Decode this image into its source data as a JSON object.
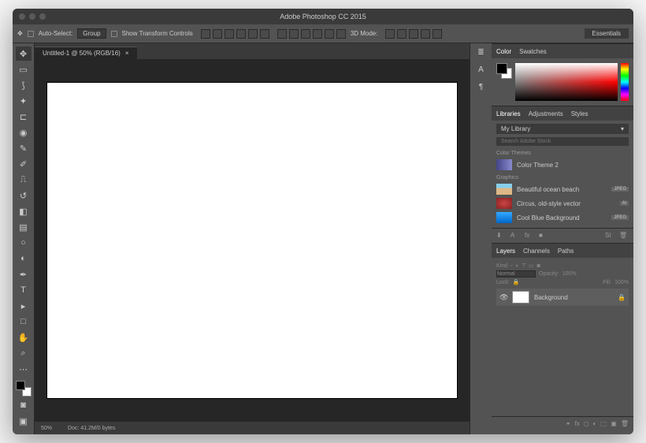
{
  "title": "Adobe Photoshop CC 2015",
  "options": {
    "auto_select": "Auto-Select:",
    "group": "Group",
    "show_transform": "Show Transform Controls",
    "mode_3d": "3D Mode:",
    "workspace": "Essentials"
  },
  "document": {
    "tab": "Untitled-1 @ 50% (RGB/16)",
    "tab_close": "×",
    "zoom": "50%",
    "doc_info": "Doc: 41.2M/0 bytes"
  },
  "panels": {
    "color": {
      "tab1": "Color",
      "tab2": "Swatches"
    },
    "libraries": {
      "tab1": "Libraries",
      "tab2": "Adjustments",
      "tab3": "Styles",
      "selected": "My Library",
      "search_placeholder": "Search Adobe Stock",
      "section_colors": "Color Themes",
      "item_ct": "Color Theme 2",
      "section_graphics": "Graphics",
      "item1": "Beautiful ocean beach",
      "badge1": "JPEG",
      "item2": "Circus, old-style vector",
      "badge2": "Ai",
      "item3": "Cool Blue Background",
      "badge3": "JPEG"
    },
    "layers": {
      "tab1": "Layers",
      "tab2": "Channels",
      "tab3": "Paths",
      "kind": "Kind",
      "blend": "Normal",
      "opacity_label": "Opacity:",
      "opacity": "100%",
      "lock_label": "Lock:",
      "fill_label": "Fill:",
      "fill": "100%",
      "layer_name": "Background"
    }
  }
}
